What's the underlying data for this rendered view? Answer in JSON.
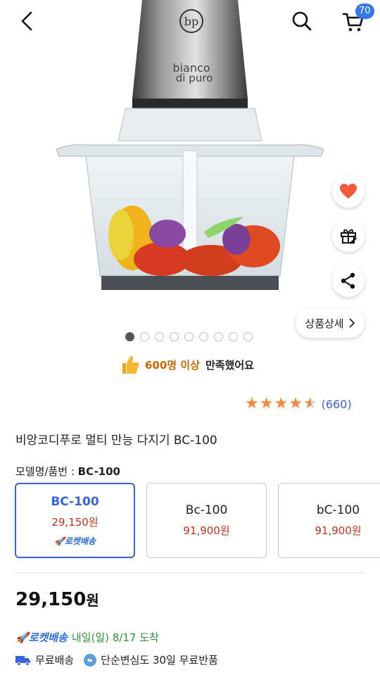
{
  "header": {
    "cart_count": "70"
  },
  "product_image": {
    "brand_line1": "bianco",
    "brand_line2": "di puro",
    "logo_text": "bp"
  },
  "actions": {
    "detail_label": "상품상세"
  },
  "carousel": {
    "total": 9,
    "active_index": 0
  },
  "satisfaction": {
    "count_text": "600명 이상",
    "rest_text": "만족했어요"
  },
  "rating": {
    "stars": 4.5,
    "review_count": "(660)"
  },
  "product": {
    "title": "비앙코디푸로 멀티 만능 다지기 BC-100",
    "model_label": "모델명/품번 : ",
    "model_value": "BC-100"
  },
  "options": [
    {
      "name": "BC-100",
      "price": "29,150원",
      "badge": "로켓배송",
      "selected": true
    },
    {
      "name": "Bc-100",
      "price": "91,900원",
      "badge": "",
      "selected": false
    },
    {
      "name": "bC-100",
      "price": "91,900원",
      "badge": "",
      "selected": false
    }
  ],
  "price": {
    "amount": "29,150",
    "unit": "원"
  },
  "delivery": {
    "badge": "로켓배송",
    "date_text": "내일(일) 8/17 도착"
  },
  "shipping": {
    "free_shipping": "무료배송",
    "return_policy": "단순변심도 30일 무료반품"
  },
  "colors": {
    "accent_blue": "#3a63d8",
    "price_red": "#b8351d",
    "star_orange": "#f4873b",
    "delivery_green": "#2f8f3c"
  }
}
